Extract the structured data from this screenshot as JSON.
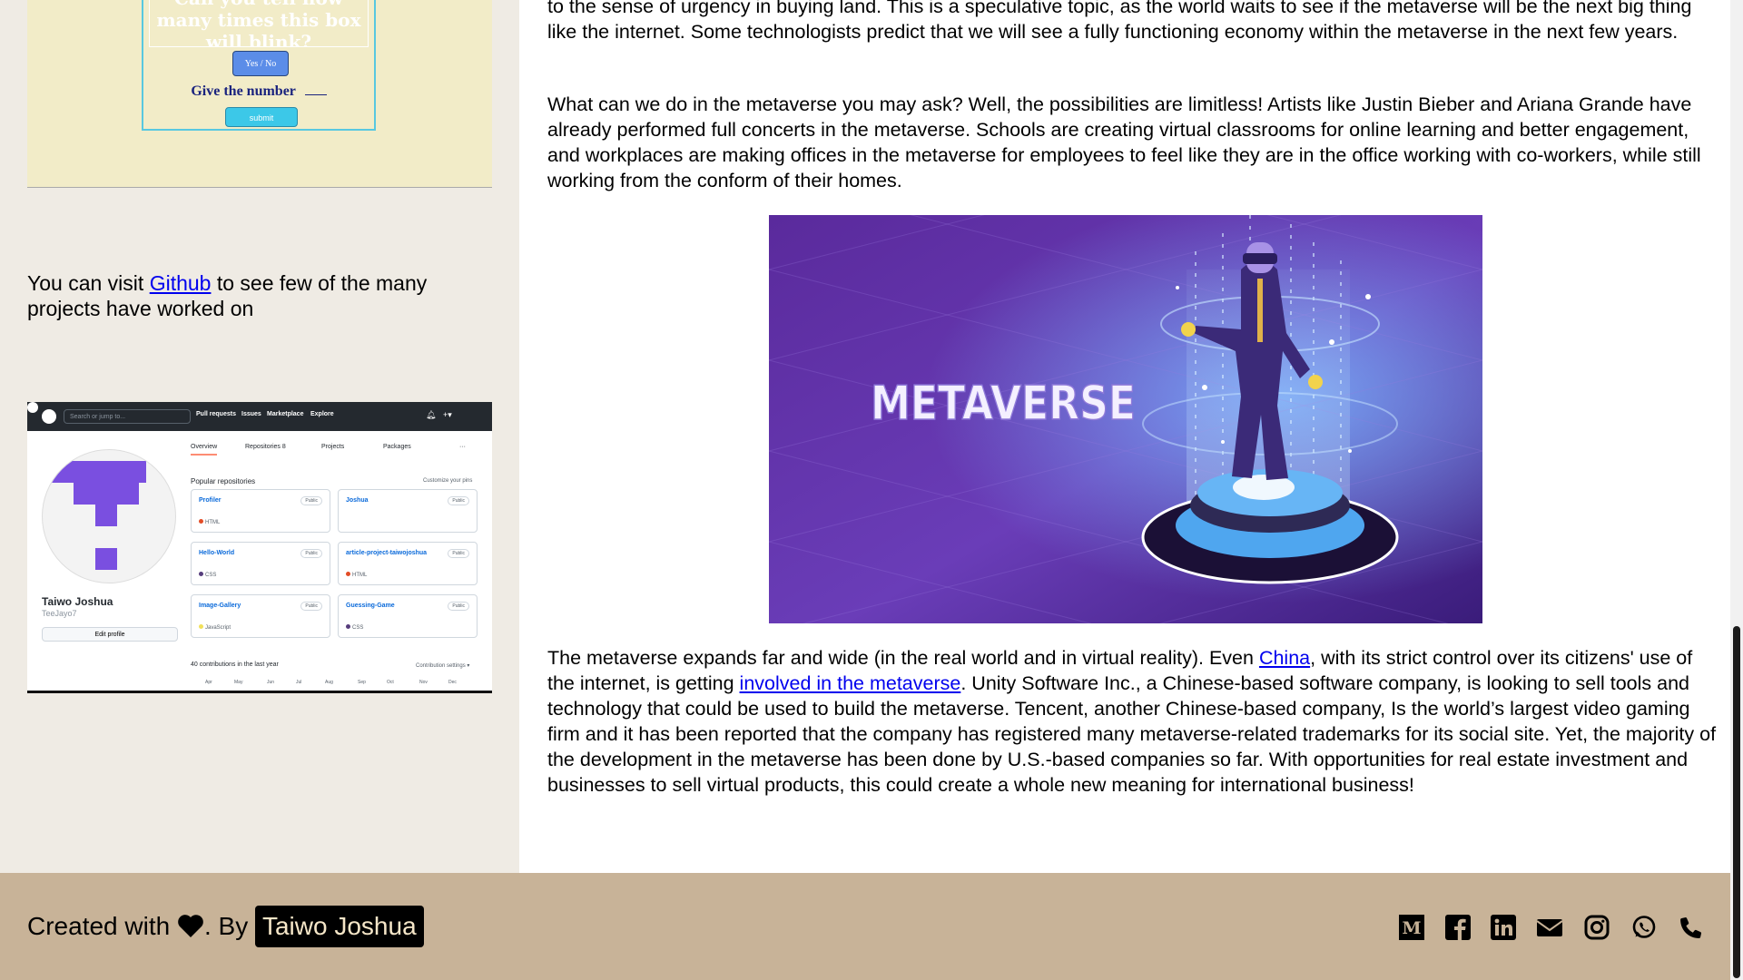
{
  "blink_widget": {
    "question": "Can you tell how many times this box will blink?",
    "yes_no_label": "Yes / No",
    "number_label": "Give the number",
    "submit_label": "submit"
  },
  "sidebar": {
    "github_before": "You can visit ",
    "github_link": "Github",
    "github_after": " to see few of the many projects have worked on"
  },
  "github_screenshot": {
    "search_placeholder": "Search or jump to...",
    "nav": [
      "Pull requests",
      "Issues",
      "Marketplace",
      "Explore"
    ],
    "tabs": [
      "Overview",
      "Repositories 8",
      "Projects",
      "Packages",
      "···"
    ],
    "name": "Taiwo Joshua",
    "username": "TeeJayo7",
    "edit_profile": "Edit profile",
    "popular_title": "Popular repositories",
    "customize": "Customize your pins",
    "repos": [
      {
        "name": "Profiler",
        "badge": "Public",
        "lang": "HTML",
        "color": "#e34c26"
      },
      {
        "name": "Joshua",
        "badge": "Public",
        "lang": "",
        "color": ""
      },
      {
        "name": "Hello-World",
        "badge": "Public",
        "lang": "CSS",
        "color": "#563d7c"
      },
      {
        "name": "article-project-taiwojoshua",
        "badge": "Public",
        "lang": "HTML",
        "color": "#e34c26"
      },
      {
        "name": "Image-Gallery",
        "badge": "Public",
        "lang": "JavaScript",
        "color": "#f1e05a"
      },
      {
        "name": "Guessing-Game",
        "badge": "Public",
        "lang": "CSS",
        "color": "#563d7c"
      }
    ],
    "contributions": "40 contributions in the last year",
    "contribution_settings": "Contribution settings ▾",
    "months": [
      "Apr",
      "May",
      "Jun",
      "Jul",
      "Aug",
      "Sep",
      "Oct",
      "Nov",
      "Dec"
    ]
  },
  "article": {
    "para_intro": "to the sense of urgency in buying land. This is a speculative topic, as the world waits to see if the metaverse will be the next big thing like the internet. Some technologists predict that we will see a fully functioning economy within the metaverse in the next few years.",
    "para_possibilities": "What can we do in the metaverse you may ask? Well, the possibilities are limitless! Artists like Justin Bieber and Ariana Grande have already performed full concerts in the metaverse. Schools are creating virtual classrooms for online learning and better engagement, and workplaces are making offices in the metaverse for employees to feel like they are in the office working with co-workers, while still working from the conform of their homes.",
    "image_text": "METAVERSE",
    "para3_part1": "The metaverse expands far and wide (in the real world and in virtual reality). Even ",
    "para3_link_china": "China",
    "para3_part2": ", with its strict control over its citizens' use of the internet, is getting ",
    "para3_link_involved": "involved in the metaverse",
    "para3_part3": ". Unity Software Inc., a Chinese-based software company, is looking to sell tools and technology that could be used to build the metaverse. Tencent, another Chinese-based company, Is the world’s largest video gaming firm and it has been reported that the company has registered many metaverse-related trademarks for its social site. Yet, the majority of the development in the metaverse has been done by U.S.-based companies so far. With opportunities for real estate investment and businesses to sell virtual products, this could create a whole new meaning for international business!"
  },
  "footer": {
    "created_with": "Created with ",
    "by": ". By ",
    "author": "Taiwo Joshua",
    "social_icons": [
      "medium-icon",
      "facebook-icon",
      "linkedin-icon",
      "mail-icon",
      "instagram-icon",
      "whatsapp-icon",
      "phone-icon"
    ],
    "bg_color": "#c8b398"
  }
}
